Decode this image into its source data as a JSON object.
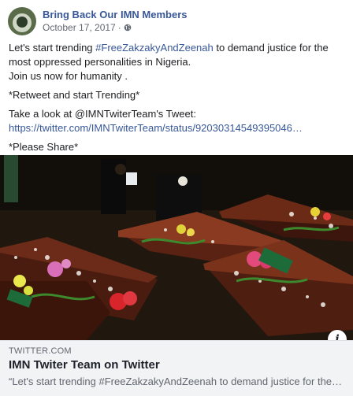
{
  "post": {
    "page_name": "Bring Back Our IMN Members",
    "date": "October 17, 2017",
    "separator": "·",
    "privacy_icon": "globe-icon",
    "text": {
      "line1_prefix": "Let's start trending ",
      "line1_hashtag": "#FreeZakzakyAndZeenah",
      "line1_suffix": " to demand justice for the",
      "line2": "most oppressed personalities in Nigeria.",
      "line3": "Join us now for humanity .",
      "line4": "*Retweet and start Trending*",
      "line5": "Take a look at @IMNTwiterTeam's Tweet:",
      "link": "https://twitter.com/IMNTwiterTeam/status/92030314549395046…",
      "line7": "*Please Share*"
    }
  },
  "link_card": {
    "domain": "TWITTER.COM",
    "title": "IMN Twiter Team on Twitter",
    "description": "“Let's start trending #FreeZakzakyAndZeenah to demand justice for the…",
    "info_label": "i"
  },
  "colors": {
    "link": "#385898",
    "card_bg": "#f2f3f5"
  }
}
